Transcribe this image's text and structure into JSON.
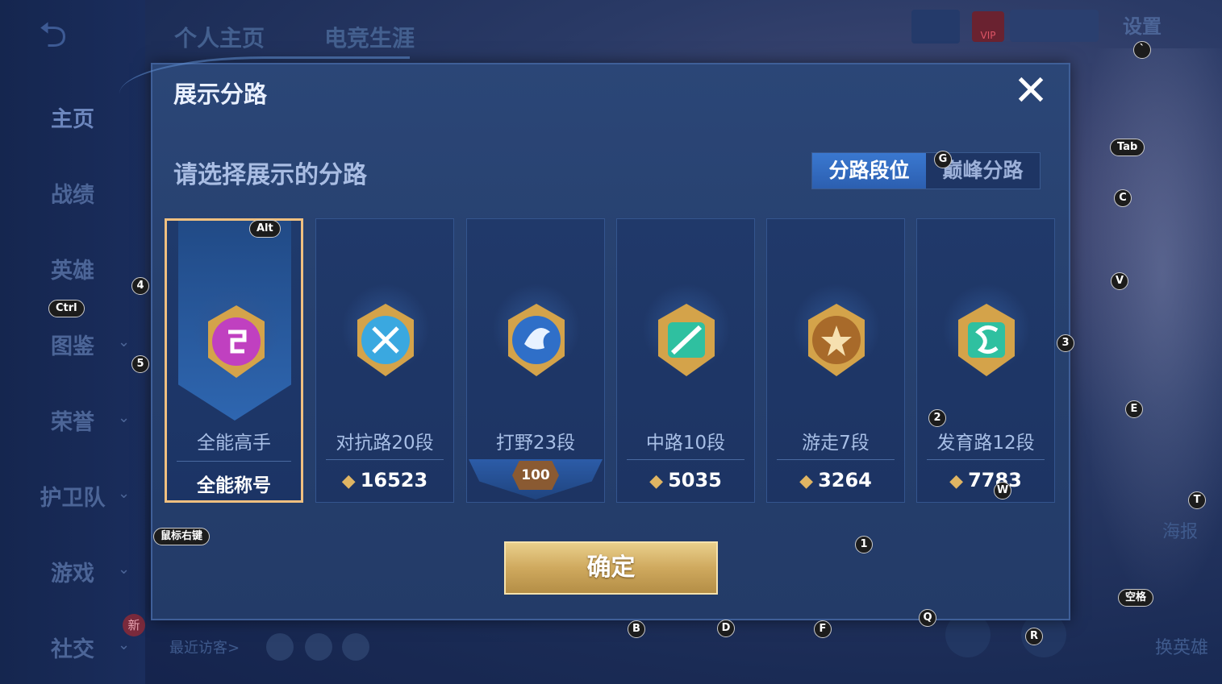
{
  "background": {
    "nav": [
      "主页",
      "战绩",
      "英雄",
      "图鉴",
      "荣誉",
      "护卫队",
      "游戏",
      "社交"
    ],
    "new_badge": "新",
    "top_tabs": [
      "个人主页",
      "电竞生涯"
    ],
    "settings_label": "设置",
    "vip_label": "VIP",
    "visitors_label": "最近访客>",
    "poster_label": "海报",
    "swap_label": "换英雄"
  },
  "modal": {
    "title": "展示分路",
    "subtitle": "请选择展示的分路",
    "close_glyph": "✕",
    "tabs": [
      "分路段位",
      "巅峰分路"
    ],
    "confirm_label": "确定"
  },
  "cards": [
    {
      "label": "全能高手",
      "footer": "全能称号",
      "selected": true,
      "badge_color": "#c040c0",
      "icon": "omni-badge-icon"
    },
    {
      "label": "对抗路20段",
      "score": "16523",
      "badge_color": "#3aa8e0",
      "icon": "clash-lane-badge-icon"
    },
    {
      "label": "打野23段",
      "peak": "100",
      "badge_color": "#2f6fc8",
      "icon": "jungle-dragon-badge-icon"
    },
    {
      "label": "中路10段",
      "score": "5035",
      "badge_color": "#2fc0a0",
      "icon": "mid-lane-badge-icon"
    },
    {
      "label": "游走7段",
      "score": "3264",
      "badge_color": "#c88a3a",
      "icon": "roam-badge-icon"
    },
    {
      "label": "发育路12段",
      "score": "7783",
      "badge_color": "#2fc0a0",
      "icon": "farm-lane-badge-icon"
    }
  ],
  "hints": {
    "alt": "Alt",
    "ctrl": "Ctrl",
    "tab": "Tab",
    "right_click": "鼠标右键",
    "space": "空格",
    "g": "G",
    "c": "C",
    "v": "V",
    "e": "E",
    "t": "T",
    "w": "W",
    "q": "Q",
    "r": "R",
    "b": "B",
    "d": "D",
    "f": "F",
    "n1": "1",
    "n2": "2",
    "n3": "3",
    "n4": "4",
    "n5": "5",
    "dot": "`"
  }
}
